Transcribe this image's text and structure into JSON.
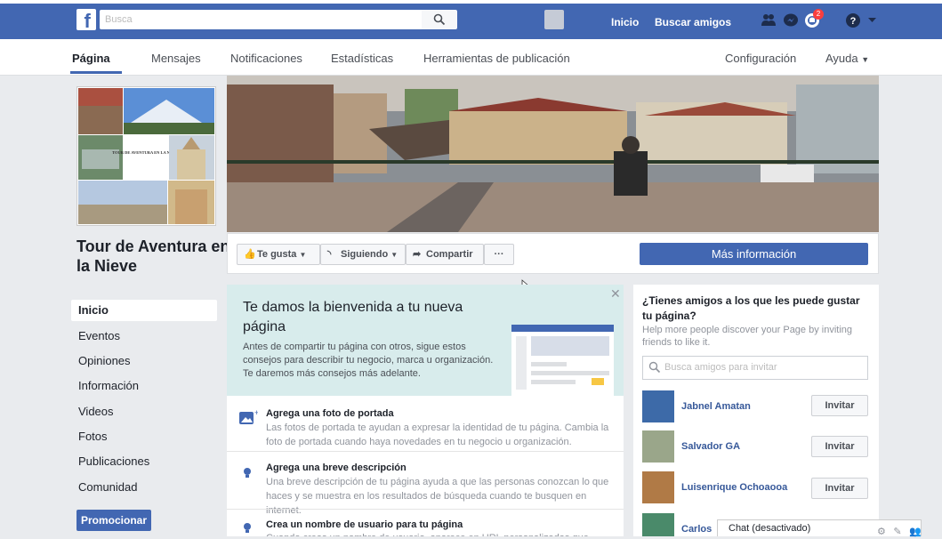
{
  "topbar": {
    "search_placeholder": "Busca",
    "nav": [
      "Inicio",
      "Buscar amigos"
    ],
    "notification_count": "2",
    "icons": [
      "friends-icon",
      "messenger-icon",
      "notifications-icon",
      "help-icon",
      "dropdown-icon"
    ]
  },
  "tabs": {
    "page": "Página",
    "messages": "Mensajes",
    "notifications": "Notificaciones",
    "stats": "Estadísticas",
    "tools": "Herramientas de publicación",
    "settings": "Configuración",
    "help": "Ayuda"
  },
  "profile": {
    "collage_text": "TOUR DE AVENTURA EN LA NIEVE",
    "page_name": "Tour de Aventura en la Nieve"
  },
  "left_nav": [
    "Inicio",
    "Eventos",
    "Opiniones",
    "Información",
    "Videos",
    "Fotos",
    "Publicaciones",
    "Comunidad"
  ],
  "promote_label": "Promocionar",
  "actions": {
    "like": "Te gusta",
    "following": "Siguiendo",
    "share": "Compartir",
    "more": "···",
    "more_info": "Más información"
  },
  "welcome": {
    "title": "Te damos la bienvenida a tu nueva página",
    "description": "Antes de compartir tu página con otros, sigue estos consejos para describir tu negocio, marca u organización. Te daremos más consejos más adelante."
  },
  "tasks": [
    {
      "title": "Agrega una foto de portada",
      "description": "Las fotos de portada te ayudan a expresar la identidad de tu página. Cambia la foto de portada cuando haya novedades en tu negocio u organización."
    },
    {
      "title": "Agrega una breve descripción",
      "description": "Una breve descripción de tu página ayuda a que las personas conozcan lo que haces y se muestra en los resultados de búsqueda cuando te busquen en internet."
    },
    {
      "title": "Crea un nombre de usuario para tu página",
      "description": "Cuando creas un nombre de usuario, aparece en URL personalizadas que muestran"
    }
  ],
  "invite": {
    "title": "¿Tienes amigos a los que les puede gustar tu página?",
    "subtitle": "Help more people discover your Page by inviting friends to like it.",
    "search_placeholder": "Busca amigos para invitar",
    "button_label": "Invitar",
    "friends": [
      "Jabnel Amatan",
      "Salvador GA",
      "Luisenrique Ochoaooa",
      "Carlos"
    ]
  },
  "chat": {
    "label": "Chat (desactivado)"
  },
  "colors": {
    "brand": "#4267b2",
    "background": "#e9ebee",
    "welcome_bg": "#d8ecec",
    "link": "#365899"
  }
}
